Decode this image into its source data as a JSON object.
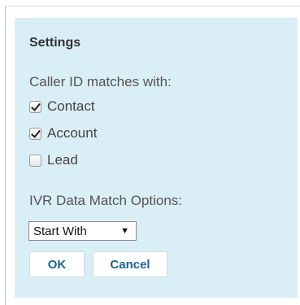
{
  "settings": {
    "title": "Settings",
    "caller_id_label": "Caller ID matches with:",
    "options": [
      {
        "label": "Contact",
        "checked": true
      },
      {
        "label": "Account",
        "checked": true
      },
      {
        "label": "Lead",
        "checked": false
      }
    ],
    "ivr_label": "IVR Data Match Options:",
    "ivr_select": {
      "value": "Start With",
      "arrow": "▼"
    },
    "ok_label": "OK",
    "cancel_label": "Cancel"
  }
}
